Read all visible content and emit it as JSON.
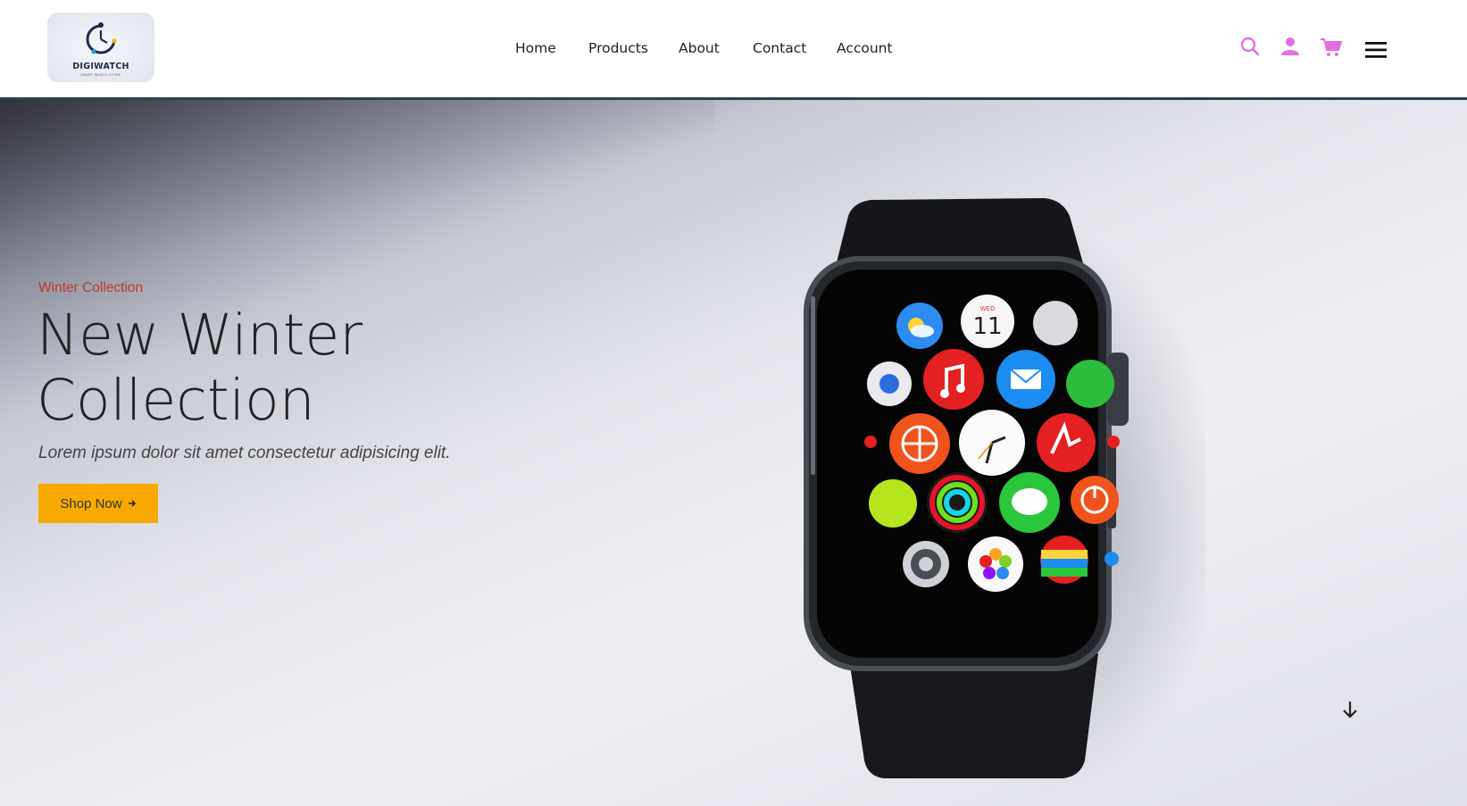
{
  "header": {
    "logo": {
      "name": "DIGIWATCH",
      "tagline": "SMART WATCH STORE"
    },
    "nav": [
      {
        "label": "Home"
      },
      {
        "label": "Products"
      },
      {
        "label": "About"
      },
      {
        "label": "Contact"
      },
      {
        "label": "Account"
      }
    ],
    "icons": [
      "search-icon",
      "user-icon",
      "cart-icon",
      "menu-icon"
    ],
    "icon_color": "#e26fe0"
  },
  "hero": {
    "eyebrow": "Winter Collection",
    "title": "New Winter Collection",
    "subtitle": "Lorem ipsum dolor sit amet consectetur adipisicing elit.",
    "cta_label": "Shop Now",
    "cta_color": "#f7a900",
    "watch_date": "11",
    "watch_day": "WED"
  }
}
